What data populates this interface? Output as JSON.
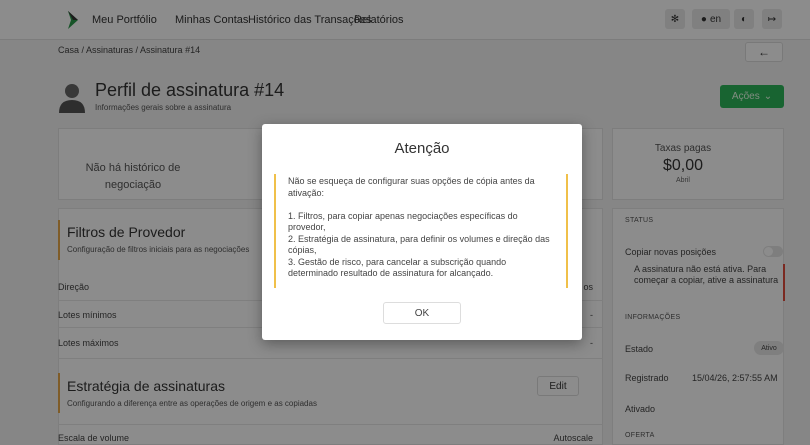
{
  "nav": {
    "links": [
      "Meu Portfólio",
      "Minhas Contas",
      "Histórico das Transações",
      "Relatórios"
    ],
    "lang_label": "en"
  },
  "breadcrumb": "Casa / Assinaturas / Assinatura #14",
  "header": {
    "title": "Perfil de assinatura #14",
    "subtitle": "Informações gerais sobre a assinatura",
    "actions_label": "Ações"
  },
  "stats": {
    "no_history_line1": "Não há histórico de",
    "no_history_line2": "negociação",
    "fees_label": "Taxas pagas",
    "fees_value": "$0,00",
    "fees_sub": "Abril"
  },
  "provider_filters": {
    "title": "Filtros de Provedor",
    "subtitle": "Configuração de filtros iniciais para as negociações",
    "rows": [
      {
        "label": "Direção",
        "value": "os"
      },
      {
        "label": "Lotes mínimos",
        "value": "-"
      },
      {
        "label": "Lotes máximos",
        "value": "-"
      }
    ]
  },
  "strategy": {
    "title": "Estratégia de assinaturas",
    "subtitle": "Configurando a diferença entre as operações de origem e as copiadas",
    "edit_label": "Edit",
    "rows": [
      {
        "label": "Escala de volume",
        "value": "Autoscale"
      }
    ]
  },
  "sidebar": {
    "status_head": "STATUS",
    "copy_label": "Copiar novas posições",
    "copy_enabled": false,
    "warning": "A assinatura não está ativa. Para começar a copiar, ative a assinatura",
    "info_head": "INFORMAÇÕES",
    "state_label": "Estado",
    "state_value": "Ativo",
    "registered_label": "Registrado",
    "registered_value": "15/04/26, 2:57:55 AM",
    "activated_label": "Ativado",
    "offer_head": "OFERTA"
  },
  "modal": {
    "title": "Atenção",
    "intro": "Não se esqueça de configurar suas opções de cópia antes da ativação:",
    "item1": "1. Filtros, para copiar apenas negociações específicas do provedor,",
    "item2": "2. Estratégia de assinatura, para definir os volumes e direção das cópias,",
    "item3": "3. Gestão de risco, para cancelar a subscrição quando determinado resultado de assinatura for alcançado.",
    "ok_label": "OK"
  }
}
